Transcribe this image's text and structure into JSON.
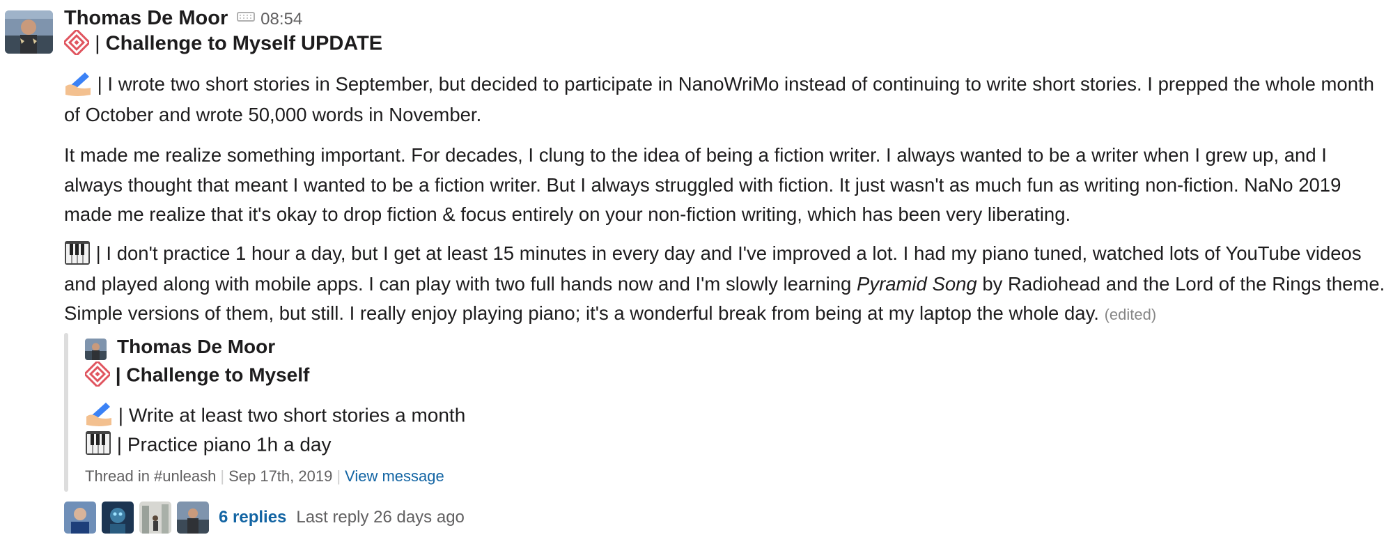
{
  "message": {
    "author": "Thomas De Moor",
    "timestamp": "08:54",
    "title": "Challenge to Myself UPDATE",
    "separator": "|",
    "paragraphs": {
      "p1": "| I wrote two short stories in September, but decided to participate in NanoWriMo instead of continuing to write short stories. I prepped the whole month of October and wrote 50,000 words in November.",
      "p2": "It made me realize something important. For decades, I clung to the idea of being a fiction writer. I always wanted to be a writer when I grew up, and I always thought that meant I wanted to be a fiction writer. But I always struggled with fiction. It just wasn't as much fun as writing non-fiction. NaNo 2019 made me realize that it's okay to drop fiction & focus entirely on your non-fiction writing, which has been very liberating.",
      "p3_before": "| I don't practice 1 hour a day, but I get at least 15 minutes in every day and I've improved a lot. I had my piano tuned, watched lots of YouTube videos and played along with mobile apps. I can play with two full hands now and I'm slowly learning ",
      "p3_italic": "Pyramid Song",
      "p3_after": " by Radiohead and the Lord of the Rings theme. Simple versions of them, but still. I really enjoy playing piano; it's a wonderful break from being at my laptop the whole day. "
    },
    "edited_label": "(edited)",
    "icons": {
      "title_emoji": "diamond-icon",
      "writing_emoji": "writing-hand-icon",
      "piano_emoji": "piano-keys-icon",
      "input_indicator": "keyboard-icon"
    }
  },
  "shared_message": {
    "author": "Thomas De Moor",
    "title": "| Challenge to Myself",
    "items": [
      "| Write at least two short stories a month",
      "| Practice piano 1h a day"
    ],
    "thread_label": "Thread in #unleash",
    "date": "Sep 17th, 2019",
    "view_link": "View message"
  },
  "replies": {
    "count_label": "6 replies",
    "last_reply": "Last reply 26 days ago"
  },
  "colors": {
    "link": "#1264a3",
    "muted": "#616061",
    "diamond": "#e0555f",
    "quote_bar": "#dddddd"
  }
}
